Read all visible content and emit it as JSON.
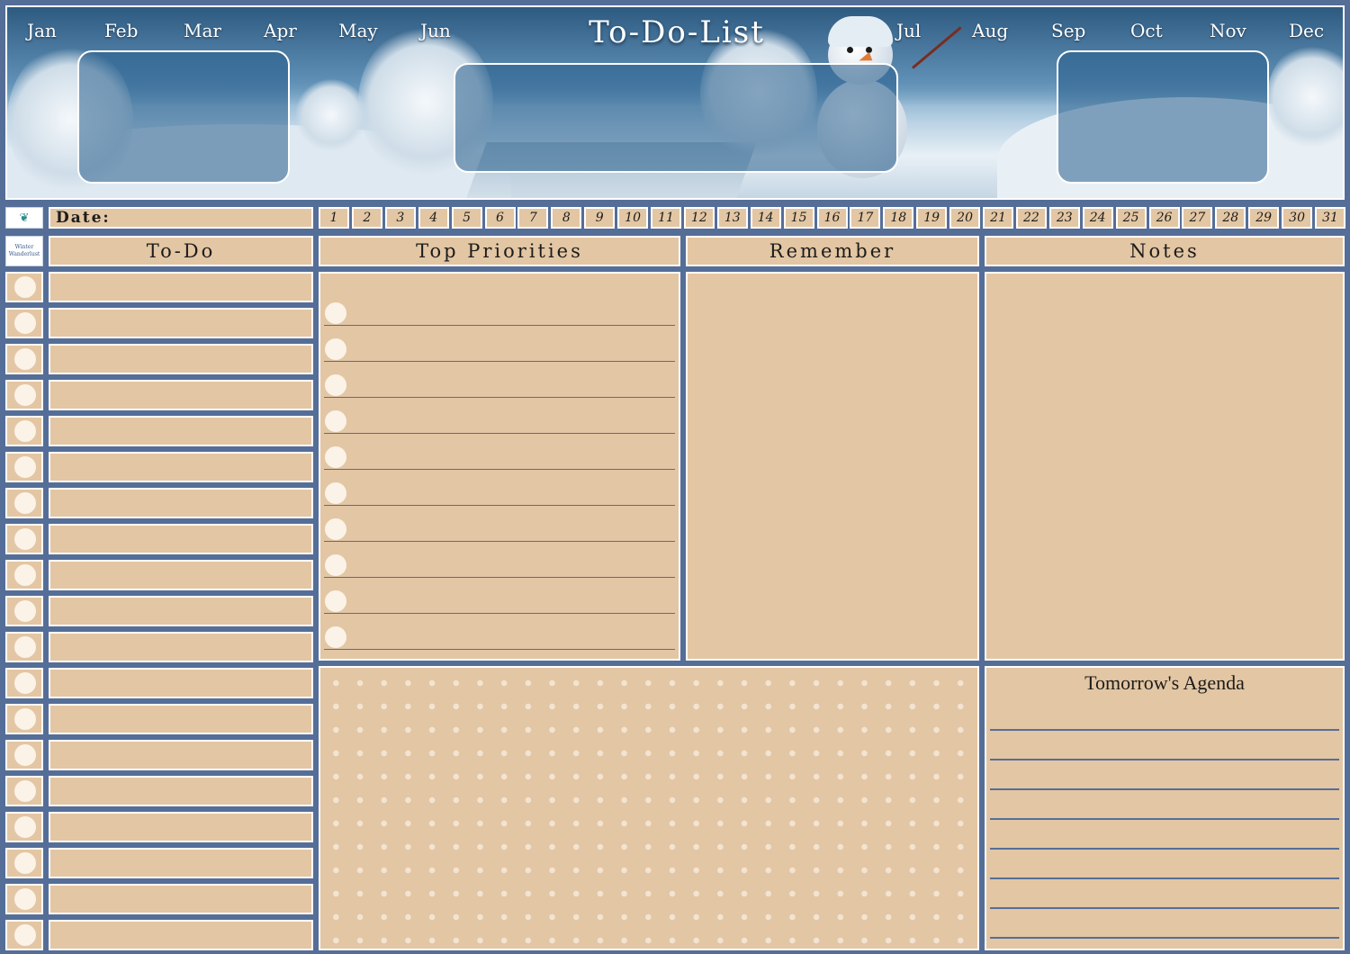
{
  "header": {
    "title": "To-Do-List",
    "months_left": [
      "Jan",
      "Feb",
      "Mar",
      "Apr",
      "May",
      "Jun"
    ],
    "months_right": [
      "Jul",
      "Aug",
      "Sep",
      "Oct",
      "Nov",
      "Dec"
    ]
  },
  "date": {
    "label": "Date:",
    "days": [
      "1",
      "2",
      "3",
      "4",
      "5",
      "6",
      "7",
      "8",
      "9",
      "10",
      "11",
      "12",
      "13",
      "14",
      "15",
      "16",
      "17",
      "18",
      "19",
      "20",
      "21",
      "22",
      "23",
      "24",
      "25",
      "26",
      "27",
      "28",
      "29",
      "30",
      "31"
    ]
  },
  "logo": {
    "line1": "Winter",
    "line2": "Wanderlust"
  },
  "sections": {
    "todo": "To-Do",
    "priorities": "Top Priorities",
    "remember": "Remember",
    "notes": "Notes",
    "agenda": "Tomorrow's Agenda"
  },
  "colors": {
    "background": "#556e98",
    "panel": "#e3c6a3",
    "border": "#ffffff",
    "circle": "#fbf3e8"
  }
}
